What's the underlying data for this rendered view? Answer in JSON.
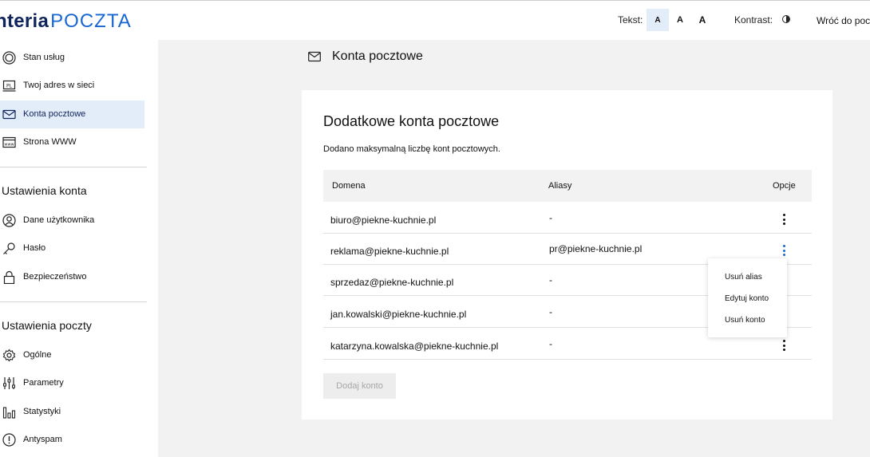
{
  "header": {
    "logo_brand": "nteria",
    "logo_product": "POCZTA",
    "text_size_label": "Tekst:",
    "text_size_options": [
      "A",
      "A",
      "A"
    ],
    "contrast_label": "Kontrast:",
    "back_link": "Wróć do poczty"
  },
  "sidebar": {
    "top_items": [
      {
        "label": "Stan usług",
        "icon": "service-status-icon"
      },
      {
        "label": "Twoj adres w sieci",
        "icon": "pl-domain-icon"
      },
      {
        "label": "Konta pocztowe",
        "icon": "envelope-icon",
        "active": true
      },
      {
        "label": "Strona WWW",
        "icon": "www-icon"
      }
    ],
    "account_settings_title": "Ustawienia konta",
    "account_items": [
      {
        "label": "Dane użytkownika",
        "icon": "user-icon"
      },
      {
        "label": "Hasło",
        "icon": "key-icon"
      },
      {
        "label": "Bezpieczeństwo",
        "icon": "lock-icon"
      }
    ],
    "mail_settings_title": "Ustawienia poczty",
    "mail_items": [
      {
        "label": "Ogólne",
        "icon": "gear-icon"
      },
      {
        "label": "Parametry",
        "icon": "sliders-icon"
      },
      {
        "label": "Statystyki",
        "icon": "bar-chart-icon"
      },
      {
        "label": "Antyspam",
        "icon": "exclamation-circle-icon"
      }
    ]
  },
  "main": {
    "page_title": "Konta pocztowe",
    "card_title": "Dodatkowe konta pocztowe",
    "info_text": "Dodano maksymalną liczbę kont pocztowych.",
    "columns": [
      "Domena",
      "Aliasy",
      "Opcje"
    ],
    "rows": [
      {
        "domain": "biuro@piekne-kuchnie.pl",
        "alias": "-"
      },
      {
        "domain": "reklama@piekne-kuchnie.pl",
        "alias": "pr@piekne-kuchnie.pl"
      },
      {
        "domain": "sprzedaz@piekne-kuchnie.pl",
        "alias": "-"
      },
      {
        "domain": "jan.kowalski@piekne-kuchnie.pl",
        "alias": "-"
      },
      {
        "domain": "katarzyna.kowalska@piekne-kuchnie.pl",
        "alias": "-"
      }
    ],
    "add_button": "Dodaj konto",
    "options_menu": [
      "Usuń alias",
      "Edytuj konto",
      "Usuń konto"
    ]
  },
  "colors": {
    "brand_dark": "#10245c",
    "brand_blue": "#1767d2",
    "active_bg": "#e3ecf9",
    "page_bg": "#f2f2f2"
  }
}
